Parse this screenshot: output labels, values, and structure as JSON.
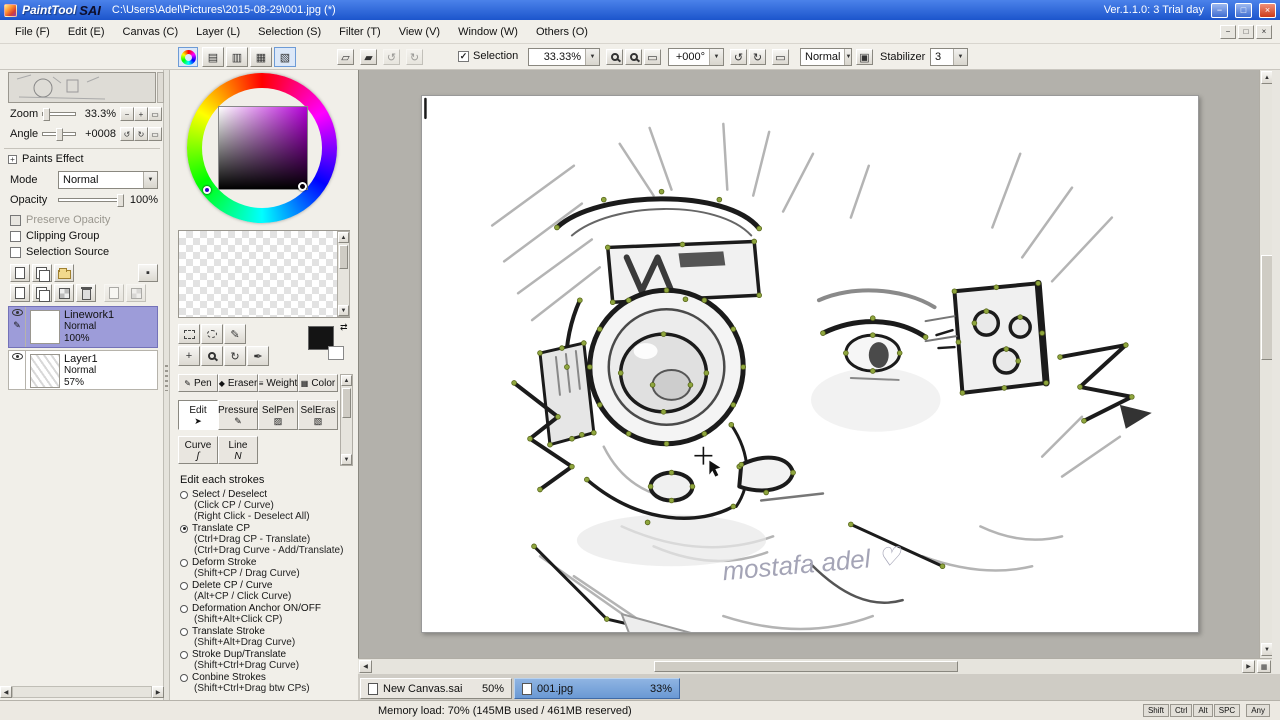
{
  "titlebar": {
    "app_script": "PaintTool",
    "app_bold": "SAI",
    "document_path": "C:\\Users\\Adel\\Pictures\\2015-08-29\\001.jpg (*)",
    "version": "Ver.1.1.0: 3 Trial day"
  },
  "menubar": {
    "items": [
      "File (F)",
      "Edit (E)",
      "Canvas (C)",
      "Layer (L)",
      "Selection (S)",
      "Filter (T)",
      "View (V)",
      "Window (W)",
      "Others (O)"
    ]
  },
  "toolbar": {
    "selection_label": "Selection",
    "zoom_value": "33.33%",
    "angle_value": "+000°",
    "blend_mode": "Normal",
    "stabilizer_label": "Stabilizer",
    "stabilizer_value": "3"
  },
  "navigator": {
    "zoom_label": "Zoom",
    "zoom_value": "33.3%",
    "angle_label": "Angle",
    "angle_value": "+0008"
  },
  "paints_effect": {
    "title": "Paints Effect",
    "mode_label": "Mode",
    "mode_value": "Normal",
    "opacity_label": "Opacity",
    "opacity_value": "100%",
    "checkboxes": [
      "Preserve Opacity",
      "Clipping Group",
      "Selection Source"
    ]
  },
  "layers": [
    {
      "name": "Linework1",
      "mode": "Normal",
      "opacity": "100%"
    },
    {
      "name": "Layer1",
      "mode": "Normal",
      "opacity": "57%"
    }
  ],
  "tool_tabs_row1": [
    "Pen",
    "Eraser",
    "Weight",
    "Color"
  ],
  "tool_tabs_row2": [
    "Edit",
    "Pressure",
    "SelPen",
    "SelEras"
  ],
  "tool_tabs_row3": [
    "Curve",
    "Line"
  ],
  "edit_strokes": {
    "title": "Edit each strokes",
    "selected_index": 1,
    "options": [
      {
        "label": "Select / Deselect",
        "subs": [
          "(Click CP / Curve)",
          "(Right Click - Deselect All)"
        ]
      },
      {
        "label": "Translate CP",
        "subs": [
          "(Ctrl+Drag CP - Translate)",
          "(Ctrl+Drag Curve - Add/Translate)"
        ]
      },
      {
        "label": "Deform Stroke",
        "subs": [
          "(Shift+CP / Drag Curve)"
        ]
      },
      {
        "label": "Delete CP / Curve",
        "subs": [
          "(Alt+CP / Click Curve)"
        ]
      },
      {
        "label": "Deformation Anchor ON/OFF",
        "subs": [
          "(Shift+Alt+Click CP)"
        ]
      },
      {
        "label": "Translate Stroke",
        "subs": [
          "(Shift+Alt+Drag Curve)"
        ]
      },
      {
        "label": "Stroke Dup/Translate",
        "subs": [
          "(Shift+Ctrl+Drag Curve)"
        ]
      },
      {
        "label": "Conbine Strokes",
        "subs": [
          "(Shift+Ctrl+Drag btw CPs)"
        ]
      }
    ]
  },
  "canvas": {
    "signature": "mostafa adel ♡"
  },
  "document_tabs": [
    {
      "name": "New Canvas.sai",
      "zoom": "50%"
    },
    {
      "name": "001.jpg",
      "zoom": "33%"
    }
  ],
  "statusbar": {
    "memory": "Memory load: 70% (145MB used / 461MB reserved)",
    "keys": [
      "Shift",
      "Ctrl",
      "Alt",
      "SPC"
    ],
    "mode_label": "Any"
  },
  "colors": {
    "titlebar_blue": "#2563d6",
    "selected_layer_purple": "#9d9cd9",
    "active_tab_blue": "#6a99d4",
    "current_color": "#141414"
  },
  "icons": {
    "color-wheel-icon": "conic hue ring",
    "magnifier-icon": "circle+handle",
    "eye-icon": "visibility",
    "pen-icon": "✎",
    "rotate-ccw-icon": "↺",
    "rotate-cw-icon": "↻",
    "swap-colors-icon": "⇄"
  }
}
